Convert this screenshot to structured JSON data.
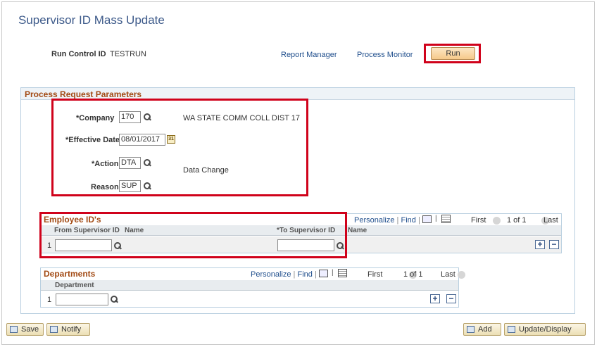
{
  "page_title": "Supervisor ID Mass Update",
  "run_control": {
    "label": "Run Control ID",
    "value": "TESTRUN"
  },
  "header_links": {
    "report_manager": "Report Manager",
    "process_monitor": "Process Monitor"
  },
  "run_button": "Run",
  "params": {
    "heading": "Process Request Parameters",
    "company": {
      "label": "*Company",
      "value": "170",
      "desc": "WA STATE COMM COLL DIST 17"
    },
    "effective_date": {
      "label": "*Effective Date",
      "value": "08/01/2017",
      "cal_glyph": "31"
    },
    "action": {
      "label": "*Action",
      "value": "DTA",
      "desc": "Data Change"
    },
    "reason": {
      "label": "Reason",
      "value": "SUP"
    }
  },
  "employee_grid": {
    "title": "Employee ID's",
    "personalize": "Personalize",
    "find": "Find",
    "sep": "|",
    "first": "First",
    "range": "1 of 1",
    "last": "Last",
    "col_from": "From Supervisor ID",
    "col_name1": "Name",
    "col_to": "*To Supervisor ID",
    "col_name2": "Name",
    "row_num": "1",
    "from_value": "",
    "to_value": ""
  },
  "dept_grid": {
    "title": "Departments",
    "personalize": "Personalize",
    "find": "Find",
    "sep": "|",
    "first": "First",
    "range": "1 of 1",
    "last": "Last",
    "col_dept": "Department",
    "row_num": "1",
    "dept_value": ""
  },
  "bottom_buttons": {
    "save": "Save",
    "notify": "Notify",
    "add": "Add",
    "update": "Update/Display"
  },
  "row_buttons": {
    "plus": "+",
    "minus": "−"
  }
}
